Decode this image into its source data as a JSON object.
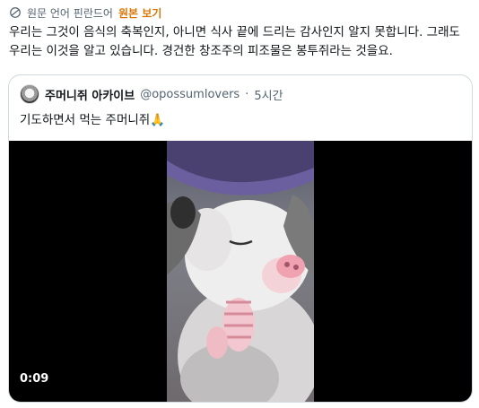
{
  "translation": {
    "label": "원문 언어 핀란드어",
    "view_original": "원본 보기"
  },
  "tweet": {
    "text": "우리는 그것이 음식의 축복인지, 아니면 식사 끝에 드리는 감사인지 알지 못합니다. 그래도 우리는 이것을 알고 있습니다. 경건한 창조주의 피조물은 봉투쥐라는 것을요."
  },
  "quote": {
    "name": "주머니쥐 아카이브",
    "handle": "@opossumlovers",
    "separator": "·",
    "time": "5시간",
    "text": "기도하면서 먹는 주머니쥐🙏",
    "video": {
      "time": "0:09"
    }
  },
  "colors": {
    "accent_orange": "#d97706",
    "muted_text": "#536471",
    "border": "#cfd9de"
  },
  "icons": {
    "translate": "translate-globe-icon",
    "video": "video-frame-opossum"
  }
}
